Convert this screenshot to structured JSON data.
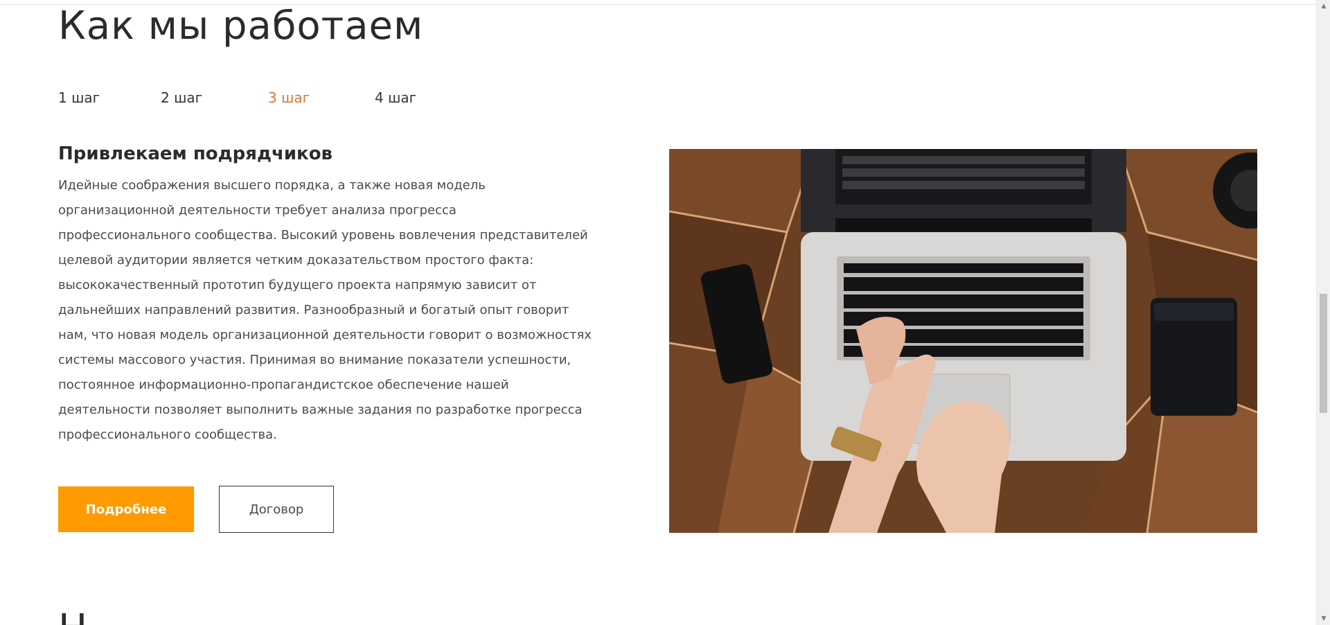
{
  "section": {
    "title": "Как мы работаем"
  },
  "steps": [
    {
      "label": "1 шаг",
      "active": false
    },
    {
      "label": "2 шаг",
      "active": false
    },
    {
      "label": "3 шаг",
      "active": true
    },
    {
      "label": "4 шаг",
      "active": false
    }
  ],
  "content": {
    "title": "Привлекаем подрядчиков",
    "body": "Идейные соображения высшего порядка, а также новая модель организационной деятельности требует анализа прогресса профессионального сообщества. Высокий уровень вовлечения представителей целевой аудитории является четким доказательством простого факта: высококачественный прототип будущего проекта напрямую зависит от дальнейших направлений развития. Разнообразный и богатый опыт говорит нам, что новая модель организационной деятельности говорит о возможностях системы массового участия. Принимая во внимание показатели успешности, постоянное информационно-пропагандистское обеспечение нашей деятельности позволяет выполнить важные задания по разработке прогресса профессионального сообщества.",
    "primary_button": "Подробнее",
    "secondary_button": "Договор"
  },
  "next_section": {
    "title_fragment": "Н"
  },
  "colors": {
    "accent": "#ff9a00",
    "active_step": "#d9773a",
    "text": "#2b2b2b"
  },
  "icons": {
    "scroll_up": "caret-up-icon",
    "scroll_down": "caret-down-icon"
  }
}
